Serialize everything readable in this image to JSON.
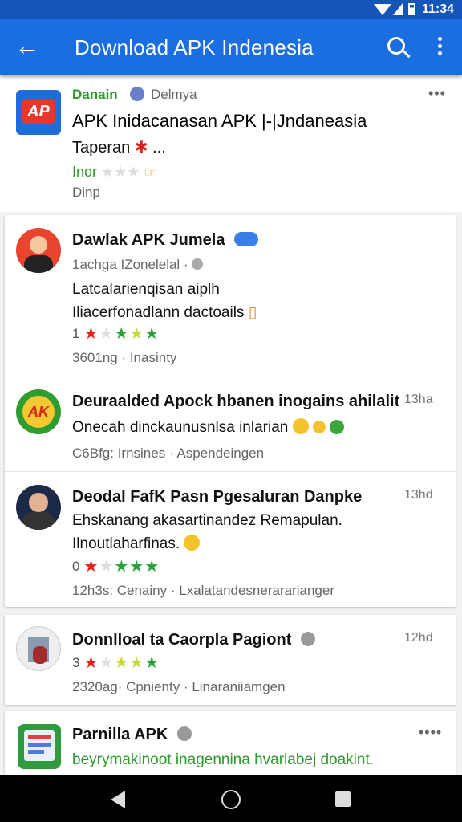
{
  "status_bar": {
    "time": "11:34"
  },
  "app_bar": {
    "title": "Download APK Indenesia"
  },
  "top_item": {
    "source": "Danain",
    "source_sub": "Delmya",
    "title": "APK Inidacanasan APK |-|Jndaneasia",
    "subtitle": "Taperan",
    "subtitle_tail": "...",
    "rating_label": "Inor",
    "meta": "Dinp"
  },
  "feed": [
    {
      "name": "Dawlak APK Jumela",
      "handle": "1achga IZonelelal ·",
      "body_line1": "Latcalarienqisan aiplh",
      "body_line2": "Iliacerfonadlann dactoails",
      "stars_num": "1",
      "meta": "3601ng · Inasinty"
    },
    {
      "name": "Deuraalded Apock hbanen inogains ahilalit",
      "time": "13ha",
      "body_line1": "Onecah dinckaunusnlsa inlarian",
      "meta": "C6Bfg: Irnsines · Aspendeingen"
    },
    {
      "name": "Deodal FafK Pasn Pgesaluran Danpke",
      "time": "13hd",
      "body_line1": "Ehskanang akasartinandez Remapulan.",
      "body_line2": "Ilnoutlaharfinas.",
      "stars_num": "0",
      "meta": "12h3s: Cenainy · Lxalatandesnerararianger"
    },
    {
      "name": "Donnlloal ta Caorpla Pagiont",
      "time": "12hd",
      "stars_num": "3",
      "meta": "2320ag· Cpnienty · Linaraniiamgen"
    },
    {
      "name": "Parnilla APK",
      "body_line1": "beyrymakinoot inagennina hvarlabej doakint."
    }
  ],
  "icons": [
    "arrow-back-icon",
    "search-icon",
    "more-vert-icon",
    "verified-icon",
    "star-icon",
    "wifi-icon",
    "signal-icon",
    "battery-icon",
    "nav-back-icon",
    "nav-home-icon",
    "nav-recents-icon"
  ],
  "colors": {
    "appbar": "#1a6ee0",
    "statusbar": "#1455b8",
    "star_red": "#e0201a",
    "star_green": "#2aa03a",
    "accent_green": "#2a9b2a"
  }
}
